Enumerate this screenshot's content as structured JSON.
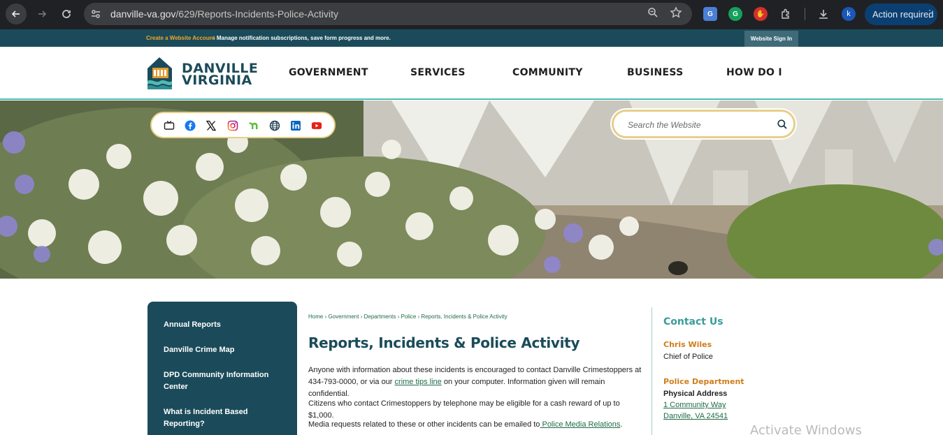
{
  "browser": {
    "url_host": "danville-va.gov",
    "url_path": "/629/Reports-Incidents-Police-Activity",
    "profile_initial": "k",
    "action_label": "Action required"
  },
  "utility_bar": {
    "create_account": "Create a Website Account",
    "manage_text": " - Manage notification subscriptions, save form progress and more.",
    "sign_in": "Website Sign In"
  },
  "header": {
    "logo_line1": "DANVILLE",
    "logo_line2": "VIRGINIA",
    "nav": [
      "GOVERNMENT",
      "SERVICES",
      "COMMUNITY",
      "BUSINESS",
      "HOW DO I"
    ]
  },
  "hero": {
    "social_icons": [
      "tv-icon",
      "facebook-icon",
      "x-twitter-icon",
      "instagram-icon",
      "nextdoor-icon",
      "globe-icon",
      "linkedin-icon",
      "youtube-icon"
    ],
    "search_placeholder": "Search the Website"
  },
  "sidebar": {
    "items": [
      "Annual Reports",
      "Danville Crime Map",
      "DPD Community Information Center",
      "What is Incident Based Reporting?"
    ]
  },
  "breadcrumb": [
    "Home",
    "Government",
    "Departments",
    "Police",
    "Reports, Incidents & Police Activity"
  ],
  "main": {
    "title": "Reports, Incidents & Police Activity",
    "p1_before": "Anyone with information about these incidents is encouraged to contact Danville Crimestoppers at 434-793-0000, or via our ",
    "p1_link": "crime tips line",
    "p1_after": " on your computer. Information given will remain confidential.",
    "p2": "Citizens who contact Crimestoppers by telephone may be eligible for a cash reward of up to $1,000.",
    "p3_before": "Media requests related to these or other incidents can be emailed to",
    "p3_link": " Police Media Relations",
    "p3_after": "."
  },
  "contact": {
    "heading": "Contact Us",
    "name": "Chris Wiles",
    "role": "Chief of Police",
    "dept": "Police Department",
    "address_label": "Physical Address",
    "address_line1": "1 Community Way",
    "address_line2": "Danville, VA 24541"
  },
  "os_watermark": "Activate Windows",
  "colors": {
    "brand_dark": "#1b4b5a",
    "accent_orange": "#cf7d1a",
    "accent_teal": "#3a9c98",
    "link_green": "#1f6b48"
  }
}
